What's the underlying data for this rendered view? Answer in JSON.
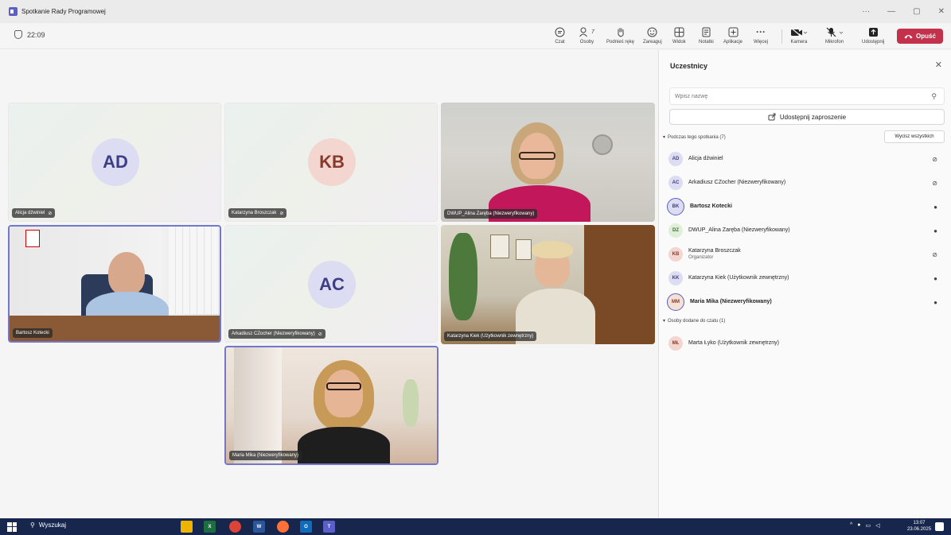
{
  "window": {
    "title": "Spotkanie Rady Programowej",
    "controls": [
      "···",
      "—",
      "▢",
      "✕"
    ]
  },
  "toolbar": {
    "timer": "22:09",
    "items": [
      {
        "label": "Czat",
        "icon": "chat-icon"
      },
      {
        "label": "Osoby",
        "icon": "people-icon",
        "count": "7",
        "active": true
      },
      {
        "label": "Podnieś rękę",
        "icon": "raise-hand-icon"
      },
      {
        "label": "Zareaguj",
        "icon": "react-icon"
      },
      {
        "label": "Widok",
        "icon": "view-icon"
      },
      {
        "label": "Notatki",
        "icon": "notes-icon"
      },
      {
        "label": "Aplikacje",
        "icon": "apps-icon"
      },
      {
        "label": "Więcej",
        "icon": "more-icon"
      },
      {
        "label": "Kamera",
        "icon": "camera-off-icon"
      },
      {
        "label": "Mikrofon",
        "icon": "mic-off-icon"
      },
      {
        "label": "Udostępnij",
        "icon": "share-icon"
      }
    ],
    "leave_label": "Opuść"
  },
  "tiles": [
    {
      "name": "Alicja dźwiniel",
      "initials": "AD",
      "muted": true,
      "type": "avatar"
    },
    {
      "name": "Katarzyna Broszczak",
      "initials": "KB",
      "muted": true,
      "type": "avatar"
    },
    {
      "name": "DWUP_Alina Zaręba (Niezweryfikowany)",
      "type": "video"
    },
    {
      "name": "Bartosz Kotecki",
      "type": "video",
      "selected": true
    },
    {
      "name": "Arkadiusz CZocher (Niezweryfikowany)",
      "initials": "AC",
      "muted": true,
      "type": "avatar"
    },
    {
      "name": "Katarzyna Kiek (Użytkownik zewnętrzny)",
      "type": "video"
    },
    {
      "name": "Maria Mika (Niezweryfikowany)",
      "type": "video",
      "selected": true
    }
  ],
  "panel": {
    "title": "Uczestnicy",
    "search_placeholder": "Wpisz nazwę",
    "share_invite": "Udostępnij zaproszenie",
    "in_meeting_header": "Podczas tego spotkania (7)",
    "mute_all": "Wycisz wszystkich",
    "participants": [
      {
        "initials": "AD",
        "name": "Alicja dźwiniel",
        "mic": "off",
        "color": "#dcdcf2"
      },
      {
        "initials": "AC",
        "name": "Arkadiusz CZocher (Niezweryfikowany)",
        "mic": "off",
        "color": "#dcdcf2"
      },
      {
        "initials": "BK",
        "name": "Bartosz Kotecki",
        "mic": "on",
        "bold": true,
        "color": "#dcdcf2"
      },
      {
        "initials": "DZ",
        "name": "DWUP_Alina Zaręba (Niezweryfikowany)",
        "mic": "on",
        "color": "#e0efd9"
      },
      {
        "initials": "KB",
        "name": "Katarzyna Broszczak",
        "sub": "Organizator",
        "mic": "off",
        "color": "#f3d6d0"
      },
      {
        "initials": "KK",
        "name": "Katarzyna Kiek (Użytkownik zewnętrzny)",
        "mic": "on",
        "color": "#dcdcf2"
      },
      {
        "initials": "MM",
        "name": "Maria Mika (Niezweryfikowany)",
        "mic": "on",
        "bold": true,
        "color": "#f3e1d6"
      }
    ],
    "chat_header": "Osoby dodane do czatu (1)",
    "chat_participants": [
      {
        "initials": "MŁ",
        "name": "Marta Łyko (Użytkownik zewnętrzny)",
        "color": "#f3d6d0"
      }
    ]
  },
  "taskbar": {
    "search": "Wyszukaj",
    "time": "13:07",
    "date": "23.06.2025"
  }
}
